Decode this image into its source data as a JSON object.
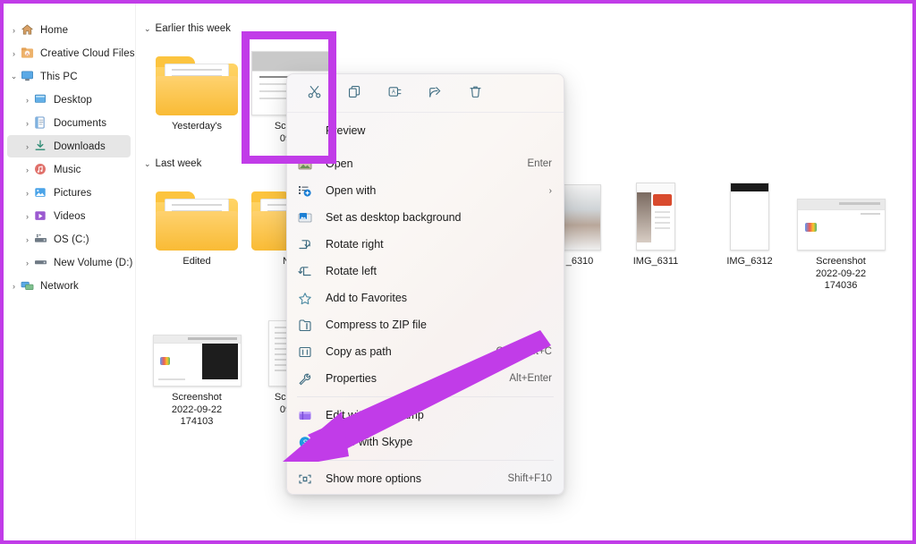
{
  "annotation": {
    "accent_color": "#c13ce8",
    "highlight_target": "Screenshot 0922-",
    "arrow_points_to": "Show more options"
  },
  "sidebar": {
    "items": [
      {
        "label": "Home",
        "icon": "home-icon",
        "indent": 1,
        "chevron": "›",
        "selected": false
      },
      {
        "label": "Creative Cloud Files",
        "icon": "creative-cloud-icon",
        "indent": 1,
        "chevron": "›",
        "selected": false
      },
      {
        "label": "This PC",
        "icon": "this-pc-icon",
        "indent": 1,
        "chevron": "⌄",
        "selected": false
      },
      {
        "label": "Desktop",
        "icon": "desktop-icon",
        "indent": 2,
        "chevron": "›",
        "selected": false
      },
      {
        "label": "Documents",
        "icon": "documents-icon",
        "indent": 2,
        "chevron": "›",
        "selected": false
      },
      {
        "label": "Downloads",
        "icon": "downloads-icon",
        "indent": 2,
        "chevron": "›",
        "selected": true
      },
      {
        "label": "Music",
        "icon": "music-icon",
        "indent": 2,
        "chevron": "›",
        "selected": false
      },
      {
        "label": "Pictures",
        "icon": "pictures-icon",
        "indent": 2,
        "chevron": "›",
        "selected": false
      },
      {
        "label": "Videos",
        "icon": "videos-icon",
        "indent": 2,
        "chevron": "›",
        "selected": false
      },
      {
        "label": "OS (C:)",
        "icon": "drive-icon",
        "indent": 2,
        "chevron": "›",
        "selected": false
      },
      {
        "label": "New Volume (D:)",
        "icon": "drive-icon",
        "indent": 2,
        "chevron": "›",
        "selected": false
      },
      {
        "label": "Network",
        "icon": "network-icon",
        "indent": 1,
        "chevron": "›",
        "selected": false
      }
    ]
  },
  "content": {
    "groups": [
      {
        "label": "Earlier this week",
        "chevron": "⌄"
      },
      {
        "label": "Last week",
        "chevron": "⌄"
      }
    ],
    "files": [
      {
        "name": "Yesterday's",
        "kind": "folder"
      },
      {
        "name": "Screens\n0922-",
        "kind": "screenshot-ui",
        "selected": true
      },
      {
        "name": "Edited",
        "kind": "folder"
      },
      {
        "name": "New",
        "kind": "folder"
      },
      {
        "name": "_6310",
        "kind": "photo"
      },
      {
        "name": "IMG_6311",
        "kind": "phone-shot"
      },
      {
        "name": "IMG_6312",
        "kind": "phone-list"
      },
      {
        "name": "Screenshot\n2022-09-22\n174036",
        "kind": "browser-shot"
      },
      {
        "name": "Screenshot\n2022-09-22\n174103",
        "kind": "terminal-shot"
      },
      {
        "name": "Screens\n0922-",
        "kind": "doc-shot"
      }
    ]
  },
  "context_menu": {
    "toolbar": [
      {
        "name": "cut",
        "icon": "scissors-icon",
        "tooltip": "Cut"
      },
      {
        "name": "copy",
        "icon": "copy-icon",
        "tooltip": "Copy"
      },
      {
        "name": "rename",
        "icon": "rename-icon",
        "tooltip": "Rename"
      },
      {
        "name": "share",
        "icon": "share-icon",
        "tooltip": "Share"
      },
      {
        "name": "delete",
        "icon": "trash-icon",
        "tooltip": "Delete"
      }
    ],
    "items": [
      {
        "label": "Preview",
        "accel": "",
        "icon": "",
        "submenu": false
      },
      {
        "label": "Open",
        "accel": "Enter",
        "icon": "open-image-icon",
        "submenu": false
      },
      {
        "label": "Open with",
        "accel": "",
        "icon": "open-with-icon",
        "submenu": true
      },
      {
        "label": "Set as desktop background",
        "accel": "",
        "icon": "desktop-background-icon",
        "submenu": false
      },
      {
        "label": "Rotate right",
        "accel": "",
        "icon": "rotate-right-icon",
        "submenu": false
      },
      {
        "label": "Rotate left",
        "accel": "",
        "icon": "rotate-left-icon",
        "submenu": false
      },
      {
        "label": "Add to Favorites",
        "accel": "",
        "icon": "star-icon",
        "submenu": false
      },
      {
        "label": "Compress to ZIP file",
        "accel": "",
        "icon": "zip-icon",
        "submenu": false
      },
      {
        "label": "Copy as path",
        "accel": "Ctrl+Shift+C",
        "icon": "copy-path-icon",
        "submenu": false
      },
      {
        "label": "Properties",
        "accel": "Alt+Enter",
        "icon": "properties-icon",
        "submenu": false
      },
      {
        "label": "Edit with Clipchamp",
        "accel": "",
        "icon": "clipchamp-icon",
        "submenu": false
      },
      {
        "label": "Share with Skype",
        "accel": "",
        "icon": "skype-icon",
        "submenu": false
      },
      {
        "label": "Show more options",
        "accel": "Shift+F10",
        "icon": "show-more-icon",
        "submenu": false
      }
    ]
  }
}
